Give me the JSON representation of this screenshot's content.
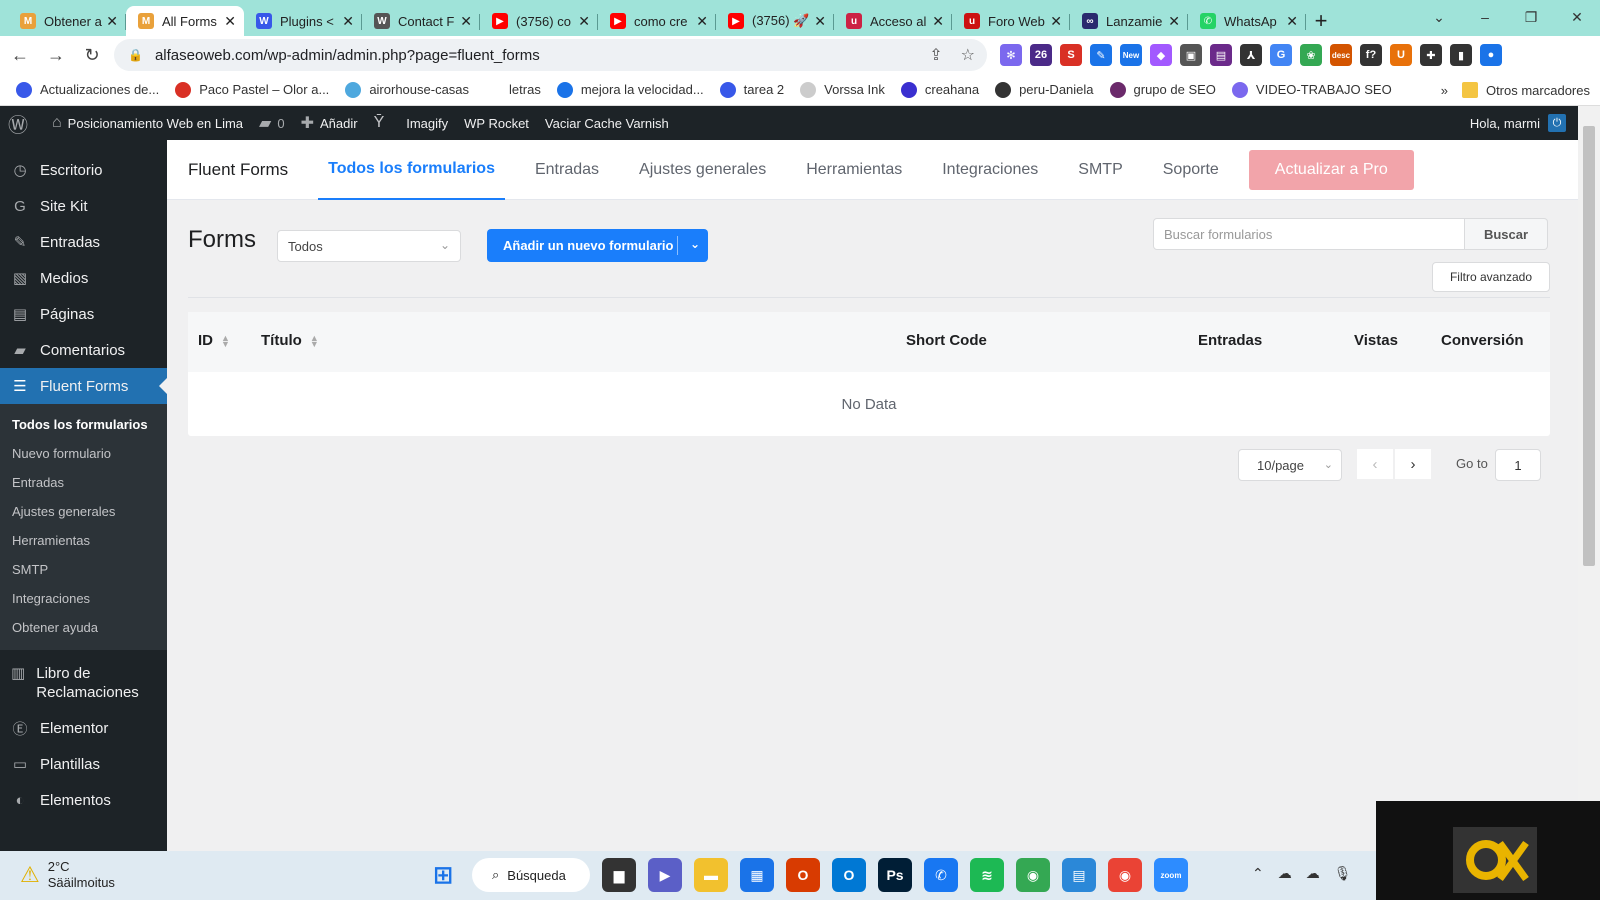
{
  "browser": {
    "tabs": [
      {
        "title": "Obtener a",
        "color": "#e9a13b",
        "glyph": "M"
      },
      {
        "title": "All Forms",
        "color": "#e9a13b",
        "glyph": "M",
        "active": true
      },
      {
        "title": "Plugins <",
        "color": "#3858e9",
        "glyph": "W"
      },
      {
        "title": "Contact F",
        "color": "#555555",
        "glyph": "W"
      },
      {
        "title": "(3756) co",
        "color": "#ff0000",
        "glyph": "▶"
      },
      {
        "title": "como cre",
        "color": "#ff0000",
        "glyph": "▶"
      },
      {
        "title": "(3756) 🚀",
        "color": "#ff0000",
        "glyph": "▶"
      },
      {
        "title": "Acceso al",
        "color": "#cc2244",
        "glyph": "u"
      },
      {
        "title": "Foro Web",
        "color": "#cc1111",
        "glyph": "u"
      },
      {
        "title": "Lanzamie",
        "color": "#2a2a6e",
        "glyph": "∞"
      },
      {
        "title": "WhatsAp",
        "color": "#25d366",
        "glyph": "✆"
      }
    ],
    "url": "alfaseoweb.com/wp-admin/admin.php?page=fluent_forms",
    "extensions": [
      {
        "color": "#7b68ee",
        "glyph": "✻"
      },
      {
        "color": "#4b2a88",
        "glyph": "26"
      },
      {
        "color": "#d93025",
        "glyph": "S"
      },
      {
        "color": "#1a73e8",
        "glyph": "✎"
      },
      {
        "color": "#1a73e8",
        "glyph": "New"
      },
      {
        "color": "#a259ff",
        "glyph": "◆"
      },
      {
        "color": "#555555",
        "glyph": "▣"
      },
      {
        "color": "#6b2a8a",
        "glyph": "▤"
      },
      {
        "color": "#333333",
        "glyph": "⅄"
      },
      {
        "color": "#4285f4",
        "glyph": "G"
      },
      {
        "color": "#34a853",
        "glyph": "❀"
      },
      {
        "color": "#d35400",
        "glyph": "desc"
      },
      {
        "color": "#333333",
        "glyph": "f?"
      },
      {
        "color": "#e8710a",
        "glyph": "U"
      },
      {
        "color": "#333333",
        "glyph": "✚"
      },
      {
        "color": "#333333",
        "glyph": "▮"
      },
      {
        "color": "#1a73e8",
        "glyph": "●"
      }
    ]
  },
  "bookmarks": {
    "items": [
      {
        "label": "Actualizaciones de...",
        "color": "#3858e9"
      },
      {
        "label": "Paco Pastel – Olor a...",
        "color": "#d93025"
      },
      {
        "label": "airorhouse-casas",
        "color": "#4ea8de"
      },
      {
        "label": "letras",
        "color": "#ffffff"
      },
      {
        "label": "mejora la velocidad...",
        "color": "#1a73e8"
      },
      {
        "label": "tarea 2",
        "color": "#3858e9"
      },
      {
        "label": "Vorssa Ink",
        "color": "#cccccc"
      },
      {
        "label": "creahana",
        "color": "#3a2fd0"
      },
      {
        "label": "peru-Daniela",
        "color": "#333333"
      },
      {
        "label": "grupo de SEO",
        "color": "#6b2a6b"
      },
      {
        "label": "VIDEO-TRABAJO SEO",
        "color": "#7b68ee"
      }
    ],
    "more": "»",
    "other_folder": "Otros marcadores"
  },
  "adminbar": {
    "site_name": "Posicionamiento Web en Lima",
    "comments_count": "0",
    "add_new": "Añadir",
    "items": [
      "Imagify",
      "WP Rocket",
      "Vaciar Cache Varnish"
    ],
    "greeting": "Hola, marmi"
  },
  "sidebar": {
    "top_items": [
      {
        "label": "Escritorio",
        "icon": "dashboard-icon",
        "glyph": "◷"
      },
      {
        "label": "Site Kit",
        "icon": "google-icon",
        "glyph": "G"
      },
      {
        "label": "Entradas",
        "icon": "pin-icon",
        "glyph": "✎"
      },
      {
        "label": "Medios",
        "icon": "media-icon",
        "glyph": "▧"
      },
      {
        "label": "Páginas",
        "icon": "pages-icon",
        "glyph": "▤"
      },
      {
        "label": "Comentarios",
        "icon": "comments-icon",
        "glyph": "▰"
      },
      {
        "label": "Fluent Forms",
        "icon": "forms-icon",
        "glyph": "☰",
        "current": true
      }
    ],
    "submenu": [
      {
        "label": "Todos los formularios",
        "current": true
      },
      {
        "label": "Nuevo formulario"
      },
      {
        "label": "Entradas"
      },
      {
        "label": "Ajustes generales"
      },
      {
        "label": "Herramientas"
      },
      {
        "label": "SMTP"
      },
      {
        "label": "Integraciones"
      },
      {
        "label": "Obtener ayuda"
      }
    ],
    "bottom_items": [
      {
        "label": "Libro de Reclamaciones",
        "icon": "book-icon",
        "glyph": "▥",
        "multi": true
      },
      {
        "label": "Elementor",
        "icon": "elementor-icon",
        "glyph": "Ⓔ"
      },
      {
        "label": "Plantillas",
        "icon": "folder-icon",
        "glyph": "▭"
      },
      {
        "label": "Elementos",
        "icon": "elements-icon",
        "glyph": "◐"
      }
    ]
  },
  "topnav": {
    "brand": "Fluent Forms",
    "links": [
      {
        "label": "Todos los formularios",
        "active": true
      },
      {
        "label": "Entradas"
      },
      {
        "label": "Ajustes generales"
      },
      {
        "label": "Herramientas"
      },
      {
        "label": "Integraciones"
      },
      {
        "label": "SMTP"
      },
      {
        "label": "Soporte"
      }
    ],
    "upgrade": "Actualizar a Pro"
  },
  "forms": {
    "title": "Forms",
    "filter_selected": "Todos",
    "add_button": "Añadir un nuevo formulario",
    "search_placeholder": "Buscar formularios",
    "search_button": "Buscar",
    "advanced_filter": "Filtro avanzado",
    "columns": {
      "id": "ID",
      "title": "Título",
      "shortcode": "Short Code",
      "entries": "Entradas",
      "views": "Vistas",
      "conversion": "Conversión"
    },
    "empty_text": "No Data",
    "pagination": {
      "per_page": "10/page",
      "goto_label": "Go to",
      "goto_value": "1"
    }
  },
  "taskbar": {
    "weather_temp": "2°C",
    "weather_desc": "Sääilmoitus",
    "search_label": "Búsqueda",
    "apps": [
      {
        "name": "files-app-icon",
        "color": "#333333",
        "glyph": "▆"
      },
      {
        "name": "teams-icon",
        "color": "#5b5fc7",
        "glyph": "▶"
      },
      {
        "name": "explorer-icon",
        "color": "#f2c12e",
        "glyph": "▬"
      },
      {
        "name": "store-icon",
        "color": "#1a73e8",
        "glyph": "▦"
      },
      {
        "name": "office-icon",
        "color": "#d83b01",
        "glyph": "O"
      },
      {
        "name": "outlook-icon",
        "color": "#0078d4",
        "glyph": "O"
      },
      {
        "name": "photoshop-icon",
        "color": "#001e36",
        "glyph": "Ps"
      },
      {
        "name": "messenger-icon",
        "color": "#1877f2",
        "glyph": "✆"
      },
      {
        "name": "spotify-icon",
        "color": "#1db954",
        "glyph": "≋"
      },
      {
        "name": "chrome-icon",
        "color": "#34a853",
        "glyph": "◉"
      },
      {
        "name": "notepad-icon",
        "color": "#2b88d8",
        "glyph": "▤"
      },
      {
        "name": "chrome-2-icon",
        "color": "#ea4335",
        "glyph": "◉"
      },
      {
        "name": "zoom-icon",
        "color": "#2d8cff",
        "glyph": "zoom"
      }
    ]
  }
}
